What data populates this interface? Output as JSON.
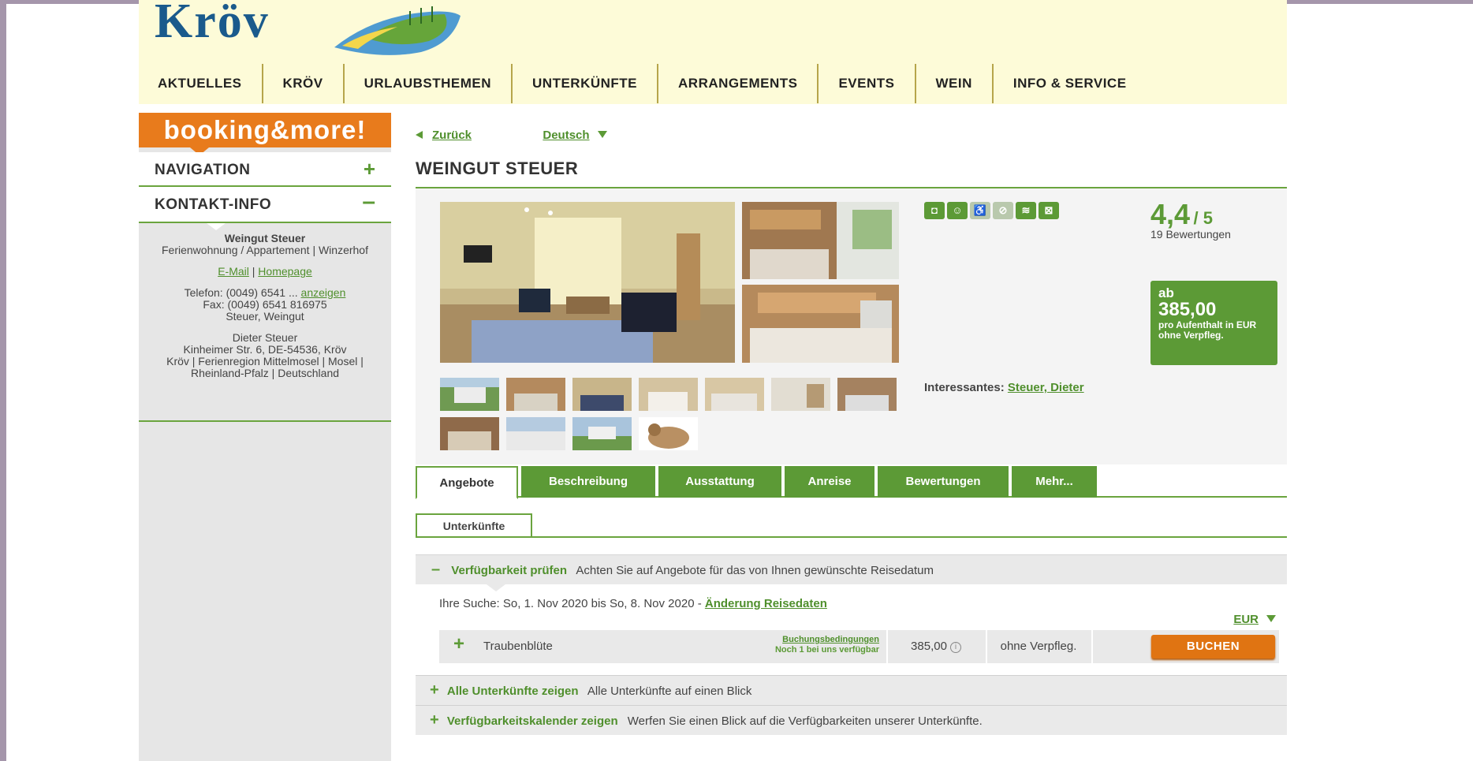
{
  "header": {
    "logo_text": "Kröv",
    "nav": [
      "AKTUELLES",
      "KRÖV",
      "URLAUBSTHEMEN",
      "UNTERKÜNFTE",
      "ARRANGEMENTS",
      "EVENTS",
      "WEIN",
      "INFO & SERVICE"
    ]
  },
  "sidebar": {
    "booking_label": "booking&more!",
    "navigation_label": "NAVIGATION",
    "navigation_toggle": "+",
    "kontakt_label": "KONTAKT-INFO",
    "kontakt_toggle": "–",
    "contact": {
      "name": "Weingut Steuer",
      "type": "Ferienwohnung / Appartement | Winzerhof",
      "email": "E-Mail",
      "separator": "|",
      "homepage": "Homepage",
      "phone_prefix": "Telefon: (0049) 6541 ...",
      "phone_show": "anzeigen",
      "fax": "Fax: (0049) 6541 816975",
      "company": "Steuer, Weingut",
      "person": "Dieter Steuer",
      "address": "Kinheimer Str. 6, DE-54536, Kröv",
      "region": "Kröv | Ferienregion Mittelmosel | Mosel | Rheinland-Pfalz | Deutschland"
    }
  },
  "main": {
    "back_link": "Zurück",
    "language": "Deutsch",
    "title": "WEINGUT STEUER",
    "amenity_icons": [
      "pet-icon",
      "child-icon",
      "wheelchair-icon",
      "nonsmoker-icon",
      "wifi-icon",
      "no-smoking-icon"
    ],
    "rating": {
      "score": "4,4",
      "of": "/ 5",
      "count": "19 Bewertungen"
    },
    "price": {
      "ab": "ab",
      "value": "385,00",
      "sub": "pro Aufenthalt in EUR ohne Verpfleg."
    },
    "interessantes_label": "Interessantes:",
    "interessantes_link": "Steuer, Dieter",
    "tabs": [
      "Angebote",
      "Beschreibung",
      "Ausstattung",
      "Anreise",
      "Bewertungen",
      "Mehr..."
    ],
    "subtab": "Unterkünfte",
    "availability": {
      "minus": "–",
      "link": "Verfügbarkeit prüfen",
      "text": "Achten Sie auf Angebote für das von Ihnen gewünschte Reisedatum"
    },
    "search": {
      "text": "Ihre Suche: So, 1. Nov 2020 bis So, 8. Nov 2020 -",
      "change_link": "Änderung Reisedaten"
    },
    "currency": "EUR",
    "offer": {
      "plus": "+",
      "name": "Traubenblüte",
      "conditions_link": "Buchungsbedingungen",
      "availability_note": "Noch 1 bei uns verfügbar",
      "price": "385,00",
      "info": "i",
      "meal": "ohne Verpfleg.",
      "book_button": "BUCHEN"
    },
    "expand_rows": [
      {
        "plus": "+",
        "link": "Alle Unterkünfte zeigen",
        "text": "Alle Unterkünfte auf einen Blick"
      },
      {
        "plus": "+",
        "link": "Verfügbarkeitskalender zeigen",
        "text": "Werfen Sie einen Blick auf die Verfügbarkeiten unserer Unterkünfte."
      }
    ]
  },
  "colors": {
    "green": "#5c9a36",
    "orange": "#e87b1c",
    "header_bg": "#fdfbd8",
    "sidebar_bg": "#e6e6e6"
  }
}
